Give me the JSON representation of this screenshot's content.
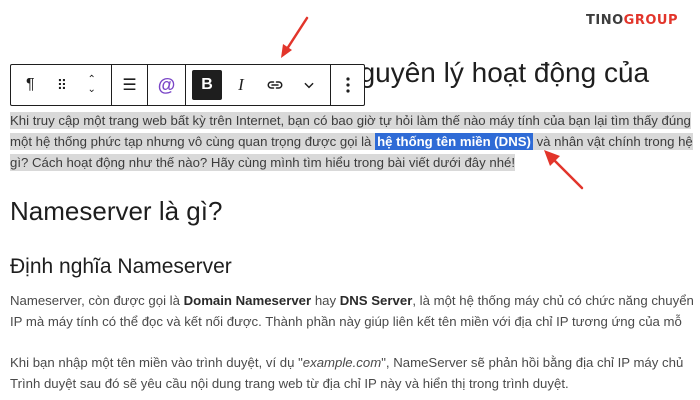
{
  "brand": {
    "prefix": "TINO",
    "suffix": "GROUP"
  },
  "toolbar": {
    "paragraph": "¶",
    "drag": "⠿",
    "move_up": "⌃",
    "move_down": "⌄",
    "align": "☰",
    "at": "@",
    "bold": "B",
    "italic": "I",
    "link": "⊃⊂",
    "more_formats": "⌄",
    "options": "⋮"
  },
  "heading_partial": "nguyên lý hoạt động của",
  "intro": {
    "line1": "Khi truy cập một trang web bất kỳ trên Internet, bạn có bao giờ tự hỏi làm thế nào máy tính của bạn lại tìm thấy đúng",
    "line2_before": "một hệ thống phức tạp nhưng vô cùng quan trọng được gọi là ",
    "line2_highlight": "hệ thống tên miền (DNS)",
    "line2_after": " và nhân vật chính trong hệ",
    "line3": "gì? Cách hoạt động như thế nào? Hãy cùng mình tìm hiểu trong bài viết dưới đây nhé!"
  },
  "h2": "Nameserver là gì?",
  "h3": "Định nghĩa Nameserver",
  "p1": {
    "a": "Nameserver, còn được gọi là ",
    "b1": "Domain Nameserver",
    "c": " hay ",
    "b2": "DNS Server",
    "d": ", là một hệ thống máy chủ có chức năng chuyển",
    "line2": "IP mà máy tính có thể đọc và kết nối được. Thành phần này giúp liên kết tên miền với địa chỉ IP tương ứng của mỗ"
  },
  "p2": {
    "a": "Khi bạn nhập một tên miền vào trình duyệt, ví dụ \"",
    "example": "example.com",
    "b": "\", NameServer sẽ phản hồi bằng địa chỉ IP máy chủ",
    "line2": "Trình duyệt sau đó sẽ yêu cầu nội dung trang web từ địa chỉ IP này và hiển thị trong trình duyệt."
  },
  "colors": {
    "arrow": "#e2352b",
    "highlight": "#2f6bd6",
    "selection": "#d9d9d9"
  }
}
